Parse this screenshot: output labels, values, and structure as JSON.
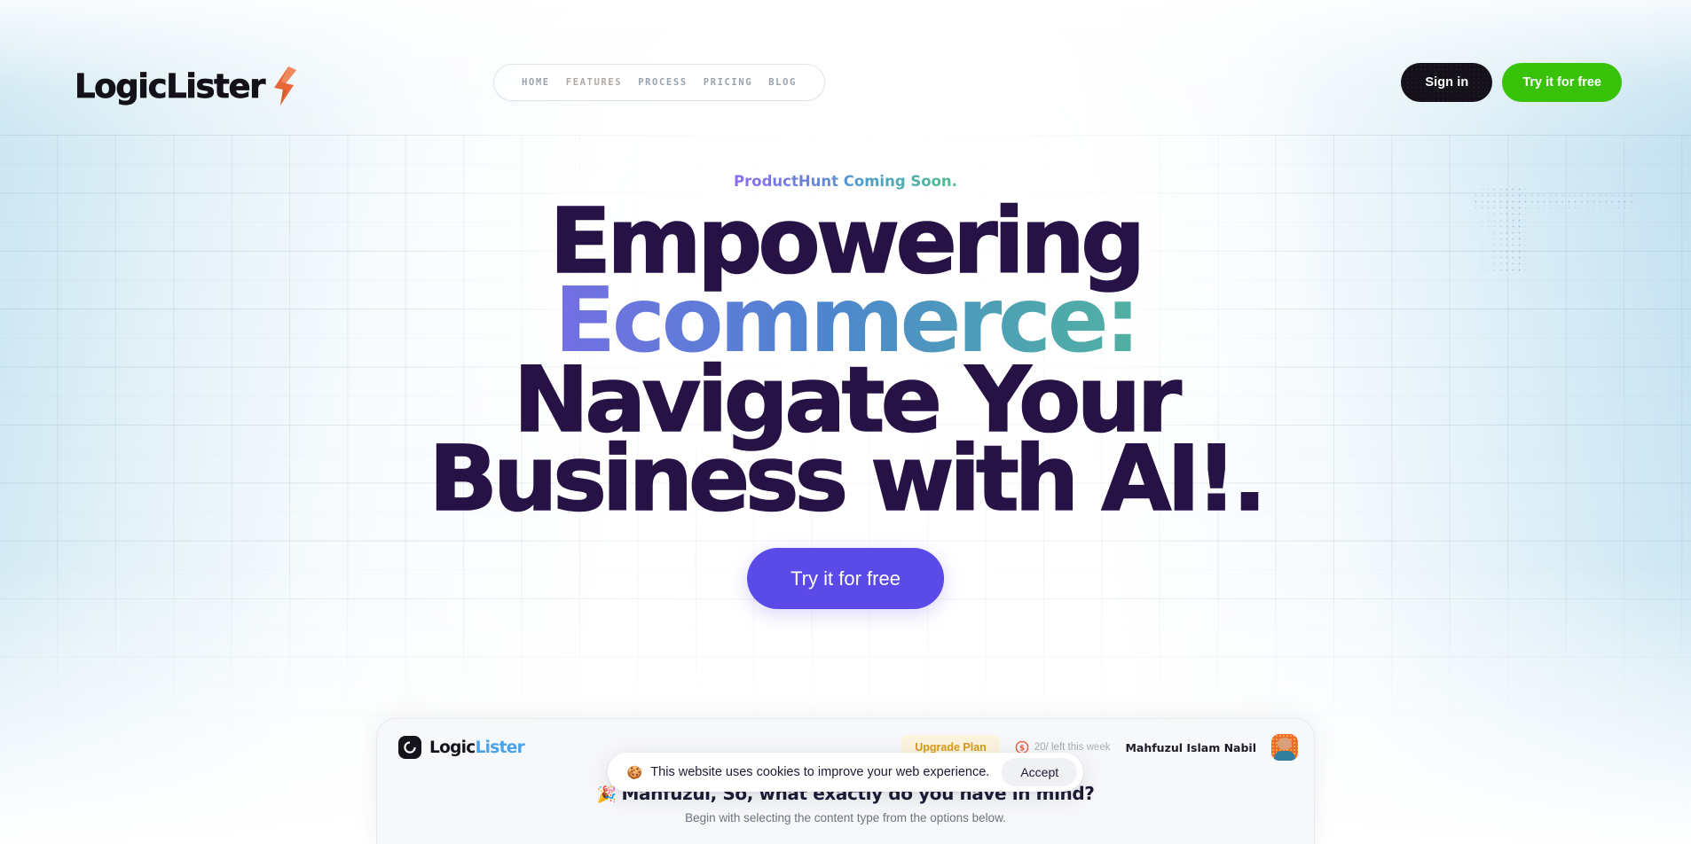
{
  "brand": {
    "name": "LogicLister",
    "bolt_icon": "lightning-bolt-icon",
    "bolt_color": "#e8673a"
  },
  "nav": {
    "items": [
      {
        "label": "HOME"
      },
      {
        "label": "FEATURES"
      },
      {
        "label": "PROCESS"
      },
      {
        "label": "PRICING"
      },
      {
        "label": "BLOG"
      }
    ]
  },
  "header_actions": {
    "signin_label": "Sign in",
    "try_label": "Try it for free",
    "signin_bg": "#14111a",
    "try_bg": "#38c20a"
  },
  "hero": {
    "eyebrow": "ProductHunt Coming Soon.",
    "title_line1": "Empowering",
    "title_line2": "Ecommerce:",
    "title_line3": "Navigate Your",
    "title_line4": "Business with AI!.",
    "title_color": "#261245",
    "gradient_stops": [
      "#8b5cf6",
      "#6f72e0",
      "#4d86cf",
      "#4fa9ab",
      "#59c088"
    ],
    "cta_label": "Try it for free",
    "cta_bg": "#5a4ae8"
  },
  "app_preview": {
    "logo_text_primary": "Logic",
    "logo_text_accent": "Lister",
    "logo_accent_color": "#4aa3e8",
    "upgrade_label": "Upgrade Plan",
    "upgrade_color": "#d99b12",
    "credits_icon": "dollar-coin-icon",
    "credits_text": "20/ left this week",
    "user_name": "Mahfuzul Islam Nabil",
    "greeting_emoji": "🎉",
    "greeting": "Mahfuzul, So, what exactly do you have in mind?",
    "subtext": "Begin with selecting the content type from the options below."
  },
  "cookie": {
    "emoji": "🍪",
    "message": "This website uses cookies to improve your web experience.",
    "accept_label": "Accept"
  }
}
